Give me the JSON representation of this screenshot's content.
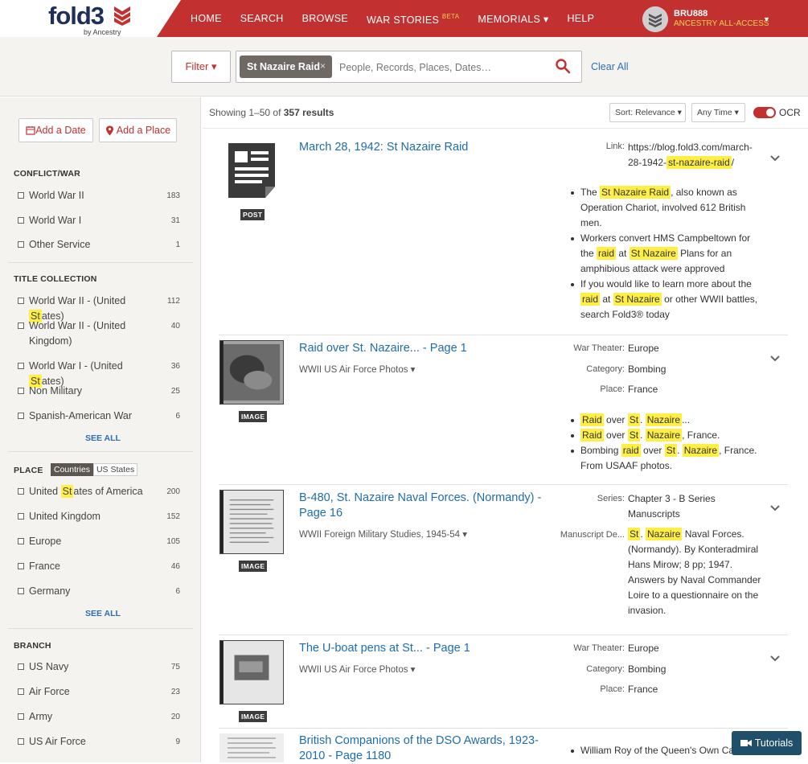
{
  "header": {
    "logo_word": "fold3",
    "logo_by": "by Ancestry",
    "nav": [
      {
        "label": "HOME"
      },
      {
        "label": "SEARCH"
      },
      {
        "label": "BROWSE"
      },
      {
        "label": "WAR STORIES",
        "badge": "BETA"
      },
      {
        "label": "MEMORIALS ▾"
      },
      {
        "label": "HELP"
      }
    ],
    "user": {
      "name": "BRU888",
      "plan": "ANCESTRY ALL-ACCESS"
    }
  },
  "search": {
    "filter_label": "Filter ▾",
    "chip_label": "St Nazaire Raid",
    "chip_remove": "×",
    "placeholder": "People, Records, Places, Dates…",
    "clear_label": "Clear All"
  },
  "sidebar": {
    "add_date": "Add a Date",
    "add_place": "Add a Place",
    "conflict": {
      "title": "CONFLICT/WAR",
      "items": [
        {
          "label": "World War II",
          "count": "183"
        },
        {
          "label": "World War I",
          "count": "31"
        },
        {
          "label": "Other Service",
          "count": "1"
        }
      ]
    },
    "title_collection": {
      "title": "TITLE COLLECTION",
      "items": [
        {
          "pre": "World War II - (United ",
          "hl": "St",
          "post": "ates)",
          "count": "112"
        },
        {
          "pre": "World War II - (United Kingdom)",
          "hl": "",
          "post": "",
          "count": "40"
        },
        {
          "pre": "World War I - (United ",
          "hl": "St",
          "post": "ates)",
          "count": "36"
        },
        {
          "pre": "Non Military",
          "hl": "",
          "post": "",
          "count": "25"
        },
        {
          "pre": "Spanish-American War",
          "hl": "",
          "post": "",
          "count": "6"
        }
      ],
      "see_all": "SEE ALL"
    },
    "place": {
      "title": "PLACE",
      "tab_countries": "Countries",
      "tab_states": "US States",
      "items": [
        {
          "pre": "United ",
          "hl": "St",
          "post": "ates of America",
          "count": "200"
        },
        {
          "pre": "United Kingdom",
          "hl": "",
          "post": "",
          "count": "152"
        },
        {
          "pre": "Europe",
          "hl": "",
          "post": "",
          "count": "105"
        },
        {
          "pre": "France",
          "hl": "",
          "post": "",
          "count": "46"
        },
        {
          "pre": "Germany",
          "hl": "",
          "post": "",
          "count": "6"
        }
      ],
      "see_all": "SEE ALL"
    },
    "branch": {
      "title": "BRANCH",
      "items": [
        {
          "label": "US Navy",
          "count": "75"
        },
        {
          "label": "Air Force",
          "count": "23"
        },
        {
          "label": "Army",
          "count": "20"
        },
        {
          "label": "US Air Force",
          "count": "9"
        }
      ]
    }
  },
  "results": {
    "showing": "Showing 1–50 of",
    "total": "357 results",
    "sort_label": "Sort: Relevance ▾",
    "time_label": "Any Time ▾",
    "ocr_label": "OCR",
    "items": [
      {
        "type": "POST",
        "title": "March 28, 1942: St Nazaire Raid",
        "link_key": "Link:",
        "link_pre": "https://blog.fold3.com/march-28-1942-",
        "link_hl": "st-nazaire-raid",
        "link_post": "/"
      },
      {
        "type": "IMAGE",
        "title": "Raid over St. Nazaire... - Page 1",
        "collection": "WWII US Air Force Photos ▾",
        "fields": [
          {
            "k": "War Theater:",
            "v": "Europe"
          },
          {
            "k": "Category:",
            "v": "Bombing"
          },
          {
            "k": "Place:",
            "v": "France"
          }
        ]
      },
      {
        "type": "IMAGE",
        "title": "B-480, St. Nazaire Naval Forces. (Normandy) - Page 16",
        "collection": "WWII Foreign Military Studies, 1945-54 ▾",
        "series_key": "Series:",
        "series_val": "Chapter 3 - B Series Manuscripts",
        "man_key": "Manuscript De...",
        "man_rest": " Naval Forces. (Normandy). By Konteradmiral Hans Mirow; 8 pp; 1947. Answers by Naval Commander Loire to a questionnaire on the invasion."
      },
      {
        "type": "IMAGE",
        "title": "The U-boat pens at St... - Page 1",
        "collection": "WWII US Air Force Photos ▾",
        "fields": [
          {
            "k": "War Theater:",
            "v": "Europe"
          },
          {
            "k": "Category:",
            "v": "Bombing"
          },
          {
            "k": "Place:",
            "v": "France"
          }
        ]
      },
      {
        "title": "British Companions of the DSO Awards, 1923-2010 - Page 1180",
        "bullet": "William Roy of the Queen's Own Ca"
      }
    ]
  },
  "tutorials_label": "Tutorials",
  "colors": {
    "brand_red": "#c23030",
    "link_blue": "#1e6cb0",
    "highlight": "#ffee44"
  }
}
